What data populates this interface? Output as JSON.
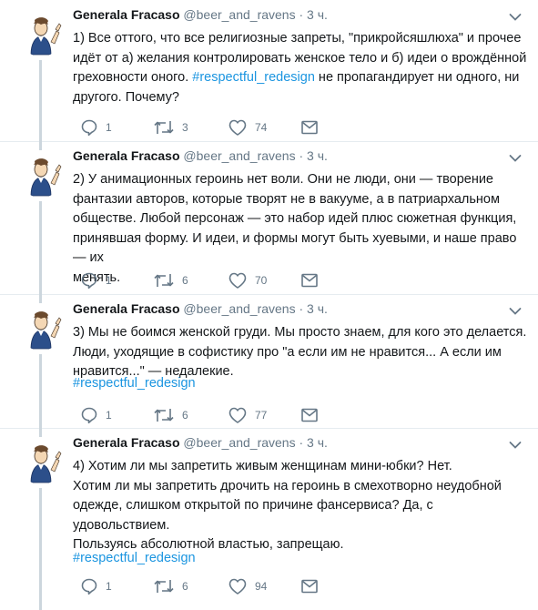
{
  "tweets": [
    {
      "name": "Generala Fracaso",
      "handle": "@beer_and_ravens",
      "dot": "·",
      "time": "3 ч.",
      "lines": [
        "1) Все оттого, что все религиозные запреты, \"прикройсяшлюха\" и прочее",
        "идёт от а) желания контролировать женское тело и б) идеи о врождённой",
        "греховности оного. "
      ],
      "tag": "#respectful_redesign",
      "after_tag": " не пропагандирует ни одного, ни",
      "last_line": "другого. Почему?",
      "replies": "1",
      "retweets": "3",
      "likes": "74"
    },
    {
      "name": "Generala Fracaso",
      "handle": "@beer_and_ravens",
      "dot": "·",
      "time": "3 ч.",
      "lines": [
        "2) У анимационных героинь нет воли. Они не люди, они — творение",
        "фантазии авторов, которые творят не в вакууме, а в патриархальном",
        "обществе. Любой персонаж — это набор идей плюс сюжетная функция,",
        "принявшая форму. И идеи, и формы могут быть хуевыми, и наше право — их",
        "менять."
      ],
      "replies": "1",
      "retweets": "6",
      "likes": "70"
    },
    {
      "name": "Generala Fracaso",
      "handle": "@beer_and_ravens",
      "dot": "·",
      "time": "3 ч.",
      "lines": [
        "3) Мы не боимся женской груди. Мы просто знаем, для кого это делается.",
        "Люди, уходящие в софистику про \"а если им не нравится... А если им",
        "нравится...\" — недалекие."
      ],
      "tag": "#respectful_redesign",
      "replies": "1",
      "retweets": "6",
      "likes": "77"
    },
    {
      "name": "Generala Fracaso",
      "handle": "@beer_and_ravens",
      "dot": "·",
      "time": "3 ч.",
      "lines": [
        "4) Хотим ли мы запретить живым женщинам мини-юбки? Нет.",
        "Хотим ли мы запретить дрочить на героинь в смехотворно неудобной",
        "одежде, слишком открытой по причине фансервиса? Да, с удовольствием.",
        "Пользуясь абсолютной властью, запрещаю."
      ],
      "tag": "#respectful_redesign",
      "replies": "1",
      "retweets": "6",
      "likes": "94"
    }
  ],
  "colors": {
    "link": "#1b95e0",
    "muted": "#657786",
    "text": "#14171a",
    "thread_line": "#ccd6dd"
  },
  "icons": {
    "reply": "reply-icon",
    "retweet": "retweet-icon",
    "like": "heart-icon",
    "message": "envelope-icon",
    "menu": "chevron-down-icon"
  }
}
